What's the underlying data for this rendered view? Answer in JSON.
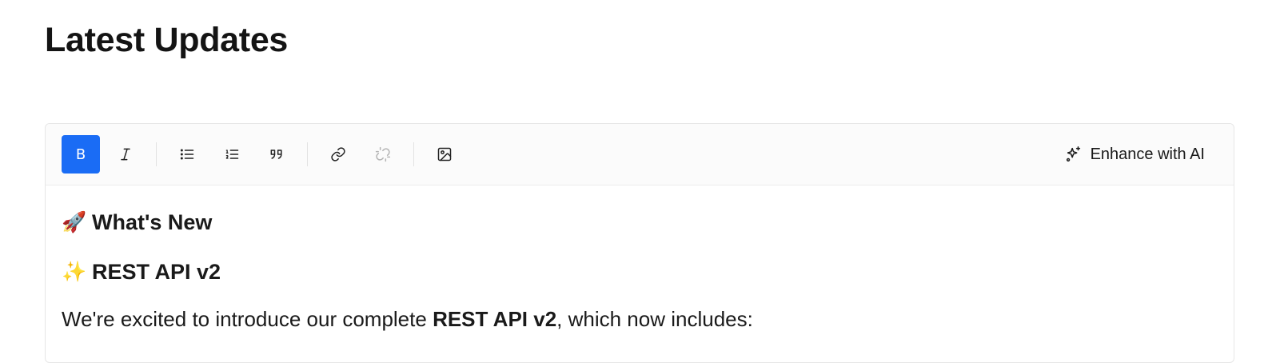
{
  "page": {
    "title": "Latest Updates"
  },
  "toolbar": {
    "bold_label": "B",
    "enhance_label": "Enhance with AI",
    "buttons": [
      "bold",
      "italic",
      "bullet-list",
      "ordered-list",
      "blockquote",
      "link",
      "unlink",
      "image"
    ],
    "active": "bold",
    "accent_color": "#1a6cf5"
  },
  "content": {
    "heading1_emoji": "🚀",
    "heading1": "What's New",
    "heading2_emoji": "✨",
    "heading2": "REST API v2",
    "paragraph_prefix": "We're excited to introduce our complete ",
    "paragraph_bold": "REST API v2",
    "paragraph_suffix": ", which now includes:"
  }
}
